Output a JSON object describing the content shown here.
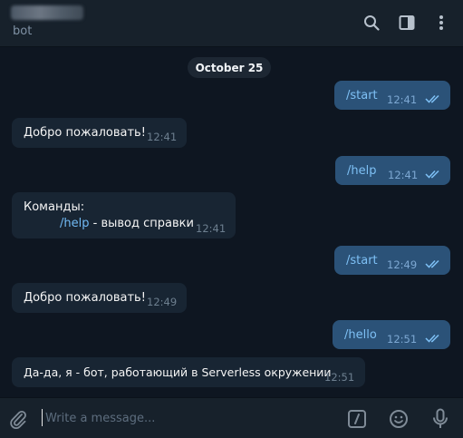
{
  "header": {
    "status": "bot",
    "icons": [
      "search-icon",
      "sidebar-toggle-icon",
      "more-vertical-icon"
    ]
  },
  "chat": {
    "date": "October 25",
    "messages": [
      {
        "dir": "out",
        "text": "/start",
        "time": "12:41",
        "read": true
      },
      {
        "dir": "in",
        "text": "Добро пожаловать!",
        "time": "12:41"
      },
      {
        "dir": "out",
        "text": "/help",
        "time": "12:41",
        "read": true
      },
      {
        "dir": "in",
        "title": "Команды:",
        "cmd": "/help",
        "desc": " - вывод справки",
        "time": "12:41"
      },
      {
        "dir": "out",
        "text": "/start",
        "time": "12:49",
        "read": true
      },
      {
        "dir": "in",
        "text": "Добро пожаловать!",
        "time": "12:49"
      },
      {
        "dir": "out",
        "text": "/hello",
        "time": "12:51",
        "read": true
      },
      {
        "dir": "in",
        "text": "Да-да, я - бот, работающий в Serverless окружении",
        "time": "12:51"
      }
    ]
  },
  "composer": {
    "placeholder": "Write a message...",
    "icons": [
      "attach-icon",
      "bot-command-icon",
      "emoji-icon",
      "microphone-icon"
    ]
  },
  "colors": {
    "background": "#0e1621",
    "panel": "#17212b",
    "outgoing_bubble": "#2b5278",
    "incoming_bubble": "#182533",
    "link": "#71baf5"
  }
}
